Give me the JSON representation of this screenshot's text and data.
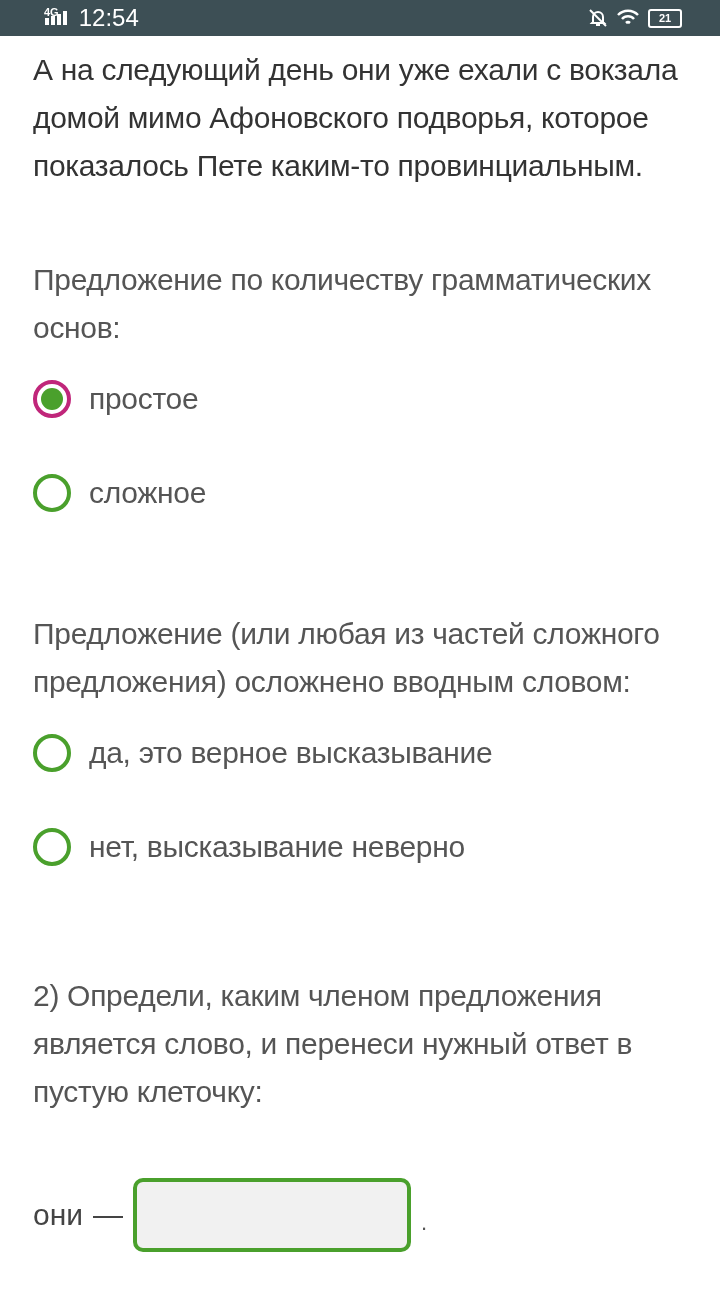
{
  "status_bar": {
    "network": "4G",
    "time": "12:54",
    "battery": "21"
  },
  "sentence": "А на следующий день они уже ехали с вокзала домой мимо Афоновского подворья, которое показалось Пете каким-то провинциальным.",
  "questions": [
    {
      "label": "Предложение по количеству грамматических основ:",
      "options": [
        {
          "label": "простое",
          "selected": true
        },
        {
          "label": "сложное",
          "selected": false
        }
      ]
    },
    {
      "label": "Предложение (или любая из частей сложного предложения) осложнено вводным словом:",
      "options": [
        {
          "label": "да, это верное высказывание",
          "selected": false
        },
        {
          "label": "нет, высказывание неверно",
          "selected": false
        }
      ]
    }
  ],
  "task": {
    "text": "2) Определи, каким членом предложения является слово, и перенеси нужный ответ в пустую клеточку:",
    "word": "они",
    "dash": "—",
    "end": "."
  }
}
